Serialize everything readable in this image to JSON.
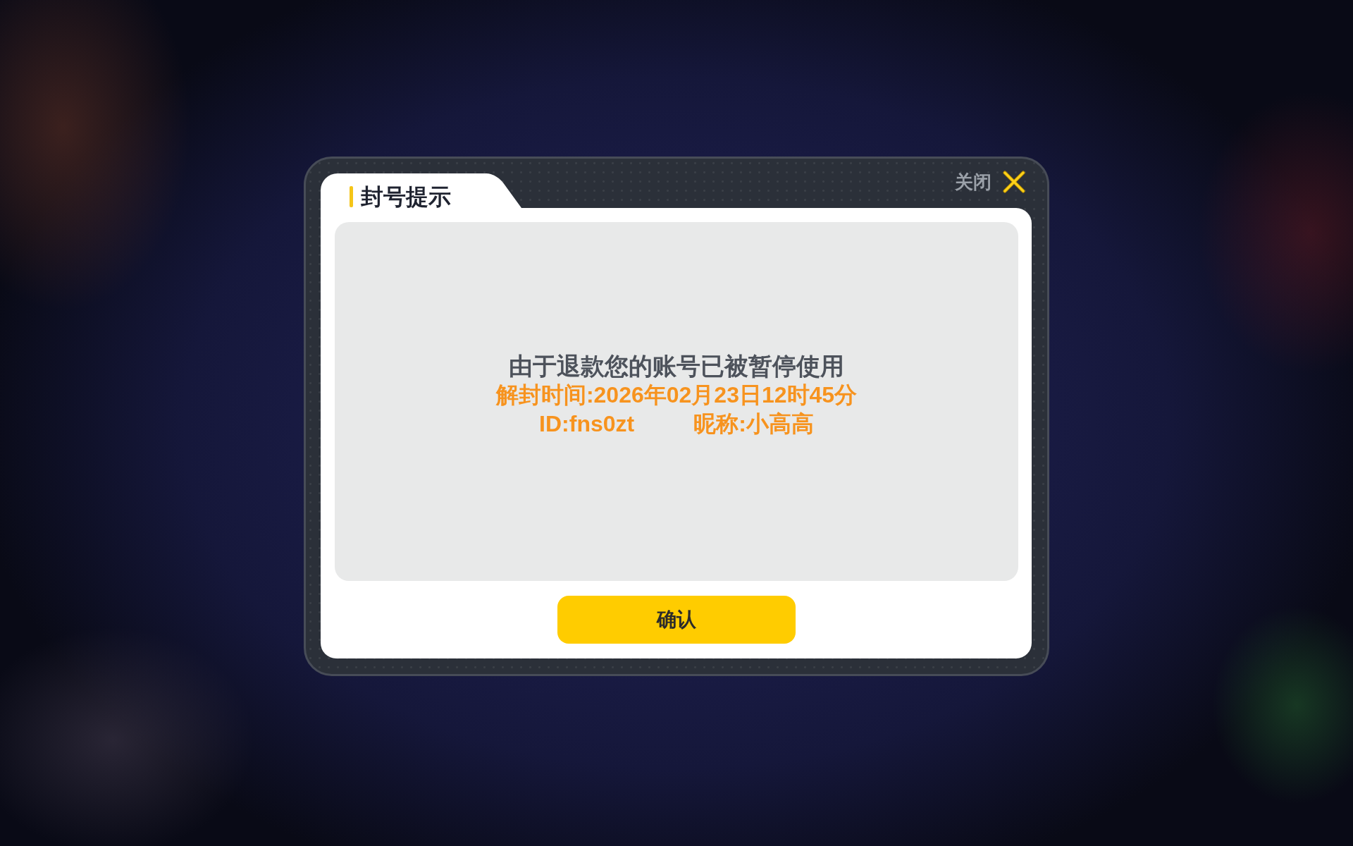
{
  "dialog": {
    "title": "封号提示",
    "close_label": "关闭",
    "message": "由于退款您的账号已被暂停使用",
    "unban_time": "解封时间:2026年02月23日12时45分",
    "player_id": "ID:fns0zt",
    "nickname": "昵称:小高高",
    "confirm_button": "确认"
  }
}
